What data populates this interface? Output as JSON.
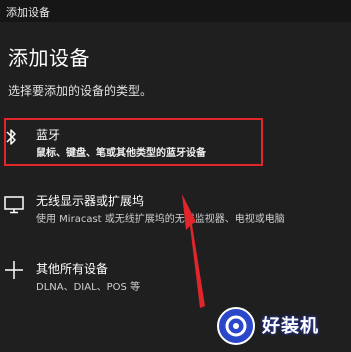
{
  "window": {
    "title": "添加设备"
  },
  "page": {
    "title": "添加设备",
    "subtitle": "选择要添加的设备的类型。"
  },
  "options": [
    {
      "icon": "bluetooth-icon",
      "title": "蓝牙",
      "description": "鼠标、键盘、笔或其他类型的蓝牙设备"
    },
    {
      "icon": "monitor-icon",
      "title": "无线显示器或扩展坞",
      "description": "使用 Miracast 或无线扩展坞的无线监视器、电视或电脑"
    },
    {
      "icon": "plus-icon",
      "title": "其他所有设备",
      "description": "DLNA、DIAL、POS 等"
    }
  ],
  "annotation": {
    "highlight_color": "#e0262a",
    "arrow_color": "#e0262a"
  },
  "watermark": {
    "text": "好装机",
    "badge_color": "#2b47c9"
  }
}
